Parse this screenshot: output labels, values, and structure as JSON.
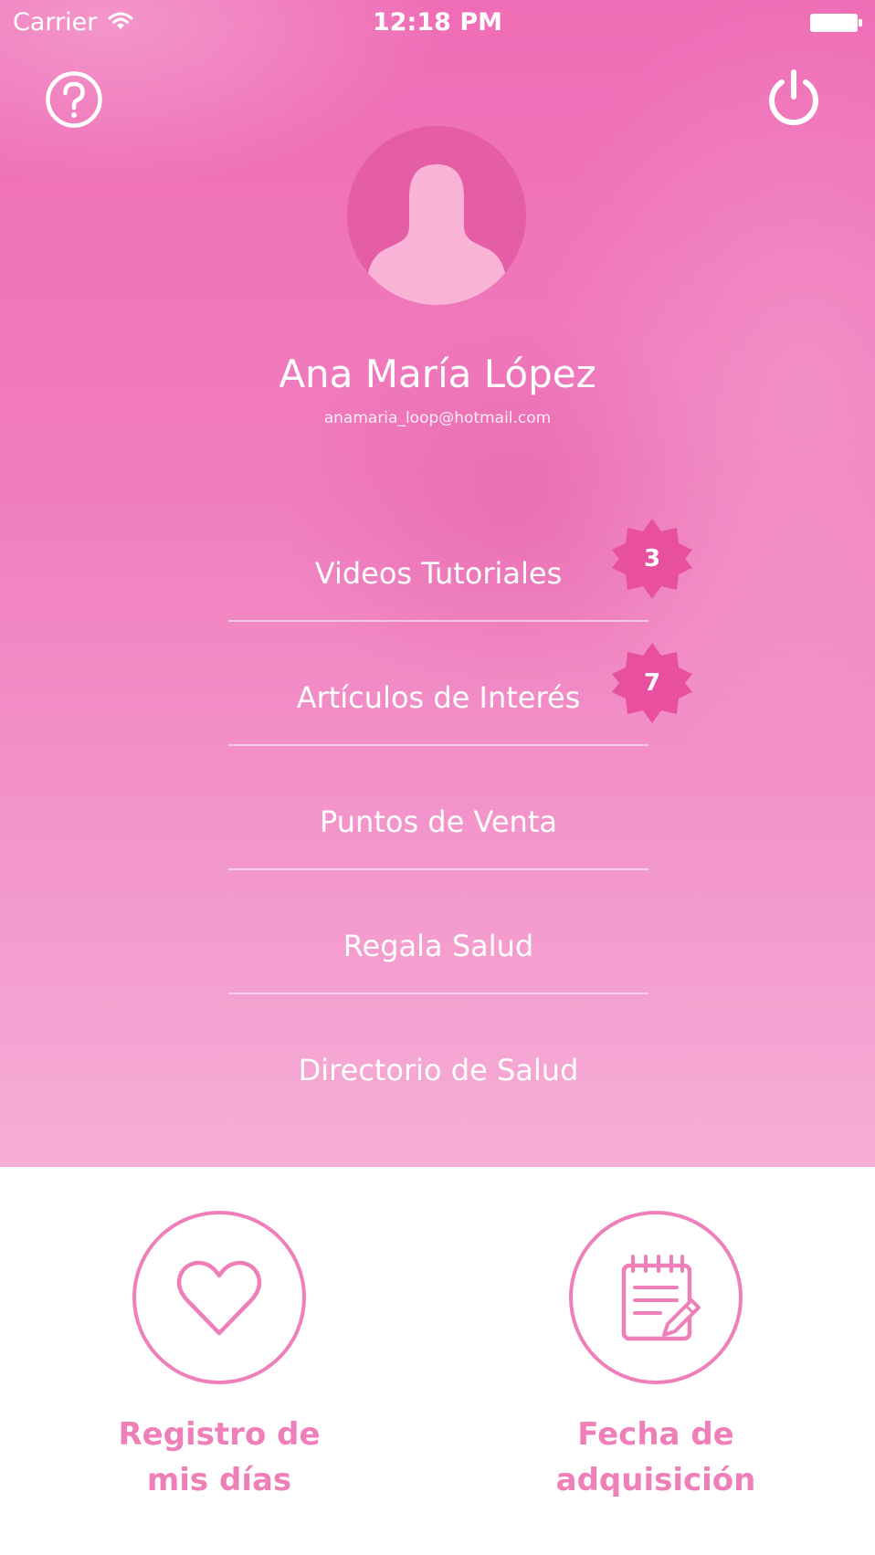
{
  "status_bar": {
    "carrier": "Carrier",
    "time": "12:18 PM",
    "wifi_icon": "wifi-icon",
    "battery_icon": "battery-icon"
  },
  "header": {
    "help_icon": "question-circle-icon",
    "power_icon": "power-icon"
  },
  "profile": {
    "avatar_icon": "user-silhouette-icon",
    "name": "Ana María López",
    "email": "anamaria_loop@hotmail.com"
  },
  "menu": {
    "items": [
      {
        "label": "Videos Tutoriales",
        "badge": "3"
      },
      {
        "label": "Artículos de Interés",
        "badge": "7"
      },
      {
        "label": "Puntos de Venta"
      },
      {
        "label": "Regala Salud"
      },
      {
        "label": "Directorio de Salud"
      }
    ]
  },
  "actions": [
    {
      "line1": "Registro de",
      "line2": "mis días",
      "icon": "heart-icon"
    },
    {
      "line1": "Fecha de",
      "line2": "adquisición",
      "icon": "notepad-pencil-icon"
    }
  ],
  "colors": {
    "hero_pink": "#ef6db6",
    "accent_pink": "#ef7fb9",
    "badge_pink": "#e94f9f",
    "avatar_bg": "#e45da5",
    "avatar_figure": "#f8b3d7"
  }
}
